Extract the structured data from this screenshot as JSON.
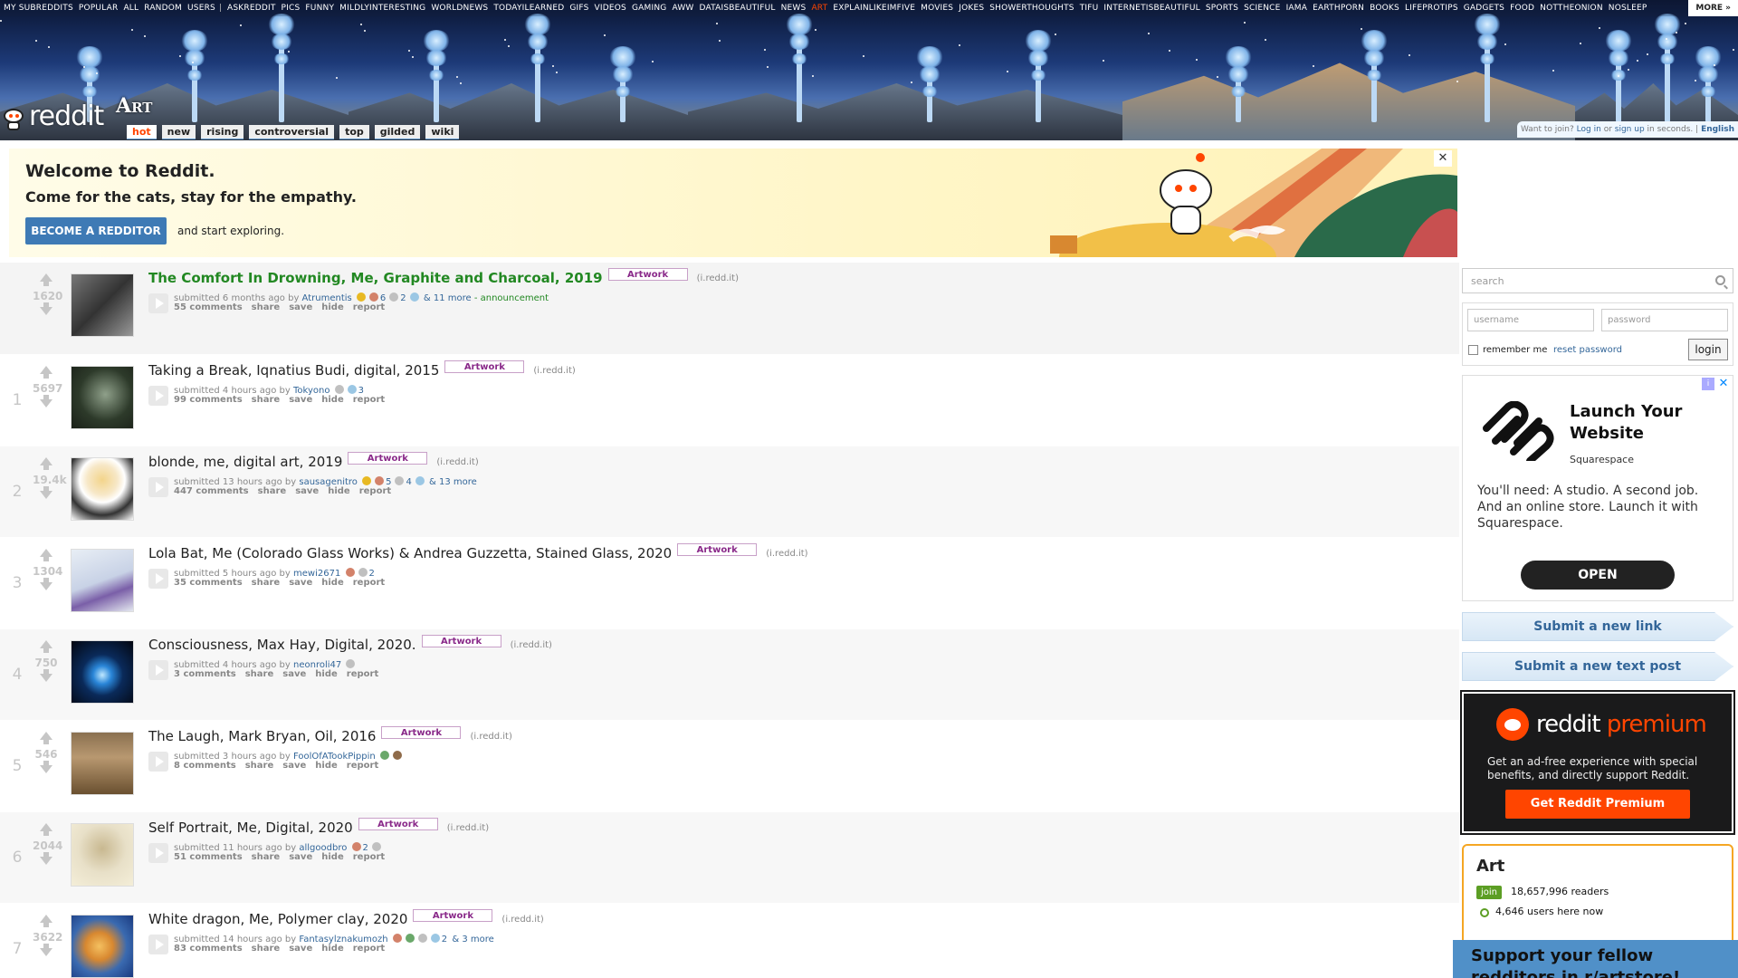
{
  "srbar": {
    "items": [
      "MY SUBREDDITS",
      "POPULAR",
      "ALL",
      "RANDOM",
      "USERS",
      "|",
      "ASKREDDIT",
      "PICS",
      "FUNNY",
      "MILDLYINTERESTING",
      "WORLDNEWS",
      "TODAYILEARNED",
      "GIFS",
      "VIDEOS",
      "GAMING",
      "AWW",
      "DATAISBEAUTIFUL",
      "NEWS",
      "ART",
      "EXPLAINLIKEIMFIVE",
      "MOVIES",
      "JOKES",
      "SHOWERTHOUGHTS",
      "TIFU",
      "INTERNETISBEAUTIFUL",
      "SPORTS",
      "SCIENCE",
      "IAMA",
      "EARTHPORN",
      "BOOKS",
      "LIFEPROTIPS",
      "GADGETS",
      "FOOD",
      "NOTTHEONION",
      "NOSLEEP"
    ],
    "selected": "ART",
    "more_label": "MORE »"
  },
  "header": {
    "logo_text": "reddit",
    "subreddit_name": "Art",
    "tabs": [
      "hot",
      "new",
      "rising",
      "controversial",
      "top",
      "gilded",
      "wiki"
    ],
    "selected_tab": "hot",
    "userbox": {
      "prefix": "Want to join?",
      "login": "Log in",
      "or": "or",
      "signup": "sign up",
      "suffix": "in seconds.",
      "sep": "|",
      "language": "English"
    }
  },
  "welcome": {
    "title": "Welcome to Reddit.",
    "subtitle": "Come for the cats, stay for the empathy.",
    "button": "BECOME A REDDITOR",
    "explore": "and start exploring.",
    "close": "✕"
  },
  "posts": [
    {
      "rank": "",
      "score": "1620",
      "title": "The Comfort In Drowning, Me, Graphite and Charcoal, 2019",
      "stickied": true,
      "flair": "Artwork",
      "domain": "(i.redd.it)",
      "submitted": "submitted 6 months ago by",
      "author": "Atrumentis",
      "awards": [
        {
          "t": "gold",
          "c": ""
        },
        {
          "t": "misc1",
          "c": "6"
        },
        {
          "t": "silver",
          "c": "2"
        },
        {
          "t": "plat",
          "c": ""
        }
      ],
      "more": "& 11 more",
      "extra": "- announcement",
      "comments": "55 comments",
      "thumb": "linear-gradient(135deg,#777,#333 50%,#999)"
    },
    {
      "rank": "1",
      "score": "5697",
      "title": "Taking a Break, Iqnatius Budi, digital, 2015",
      "flair": "Artwork",
      "domain": "(i.redd.it)",
      "submitted": "submitted 4 hours ago by",
      "author": "Tokyono",
      "awards": [
        {
          "t": "silver",
          "c": ""
        },
        {
          "t": "plat",
          "c": "3"
        }
      ],
      "more": "",
      "extra": "",
      "comments": "99 comments",
      "thumb": "radial-gradient(circle at 55% 45%,#8fa08a,#2d3a2a 55%,#1a2018)"
    },
    {
      "rank": "2",
      "score": "19.4k",
      "title": "blonde, me, digital art, 2019",
      "flair": "Artwork",
      "domain": "(i.redd.it)",
      "submitted": "submitted 13 hours ago by",
      "author": "sausagenitro",
      "awards": [
        {
          "t": "gold",
          "c": ""
        },
        {
          "t": "misc1",
          "c": "5"
        },
        {
          "t": "silver",
          "c": "4"
        },
        {
          "t": "plat",
          "c": ""
        }
      ],
      "more": "& 13 more",
      "extra": "",
      "comments": "447 comments",
      "thumb": "radial-gradient(circle at 50% 35%,#f3d48a,#f7e8c8 30%,#fff 45%,#333 70%,#fff)"
    },
    {
      "rank": "3",
      "score": "1304",
      "title": "Lola Bat, Me (Colorado Glass Works) & Andrea Guzzetta, Stained Glass, 2020",
      "flair": "Artwork",
      "domain": "(i.redd.it)",
      "submitted": "submitted 5 hours ago by",
      "author": "mewi2671",
      "awards": [
        {
          "t": "misc1",
          "c": ""
        },
        {
          "t": "silver",
          "c": "2"
        }
      ],
      "more": "",
      "extra": "",
      "comments": "35 comments",
      "thumb": "linear-gradient(160deg,#e8eef5,#c8d2e6 50%,#7a5fa8 70%,#e4e8f0)"
    },
    {
      "rank": "4",
      "score": "750",
      "title": "Consciousness, Max Hay, Digital, 2020.",
      "flair": "Artwork",
      "domain": "(i.redd.it)",
      "submitted": "submitted 4 hours ago by",
      "author": "neonroli47",
      "awards": [
        {
          "t": "silver",
          "c": ""
        }
      ],
      "more": "",
      "extra": "",
      "comments": "3 comments",
      "thumb": "radial-gradient(circle at 50% 55%,#bfe8ff,#2a86d8 20%,#0a2a5a 45%,#03060f)"
    },
    {
      "rank": "5",
      "score": "546",
      "title": "The Laugh, Mark Bryan, Oil, 2016",
      "flair": "Artwork",
      "domain": "(i.redd.it)",
      "submitted": "submitted 3 hours ago by",
      "author": "FoolOfATookPippin",
      "awards": [
        {
          "t": "misc2",
          "c": ""
        },
        {
          "t": "misc3",
          "c": ""
        }
      ],
      "more": "",
      "extra": "",
      "comments": "8 comments",
      "thumb": "linear-gradient(180deg,#8a7050,#b89870 40%,#6a5030)"
    },
    {
      "rank": "6",
      "score": "2044",
      "title": "Self Portrait, Me, Digital, 2020",
      "flair": "Artwork",
      "domain": "(i.redd.it)",
      "submitted": "submitted 11 hours ago by",
      "author": "allgoodbro",
      "awards": [
        {
          "t": "misc1",
          "c": "2"
        },
        {
          "t": "silver",
          "c": ""
        }
      ],
      "more": "",
      "extra": "",
      "comments": "51 comments",
      "thumb": "radial-gradient(circle at 50% 40%,#c8b890,#e8e0c8 50%,#f4eed8)"
    },
    {
      "rank": "7",
      "score": "3622",
      "title": "White dragon, Me, Polymer clay, 2020",
      "flair": "Artwork",
      "domain": "(i.redd.it)",
      "submitted": "submitted 14 hours ago by",
      "author": "Fantasylznakumozh",
      "awards": [
        {
          "t": "misc1",
          "c": ""
        },
        {
          "t": "misc2",
          "c": ""
        },
        {
          "t": "silver",
          "c": ""
        },
        {
          "t": "plat",
          "c": "2"
        }
      ],
      "more": "& 3 more",
      "extra": "",
      "comments": "83 comments",
      "thumb": "radial-gradient(circle at 45% 50%,#f4c060,#d88830 30%,#3a6ab0 60%,#1a3a80)"
    }
  ],
  "post_buttons": [
    "share",
    "save",
    "hide",
    "report"
  ],
  "sidebar": {
    "search_placeholder": "search",
    "username_placeholder": "username",
    "password_placeholder": "password",
    "remember_me": "remember me",
    "reset_password": "reset password",
    "login": "login",
    "ad": {
      "info": "i",
      "close": "✕",
      "title": "Launch Your Website",
      "brand": "Squarespace",
      "body": "You'll need: A studio. A second job. And an online store. Launch it with Squarespace.",
      "cta": "OPEN"
    },
    "submit_link": "Submit a new link",
    "submit_text": "Submit a new text post",
    "premium": {
      "word1": "reddit",
      "word2": "premium",
      "text": "Get an ad-free experience with special benefits, and directly support Reddit.",
      "button": "Get Reddit Premium"
    },
    "subinfo": {
      "name": "Art",
      "join": "join",
      "readers": "18,657,996 readers",
      "online": "4,646 users here now"
    },
    "support": "Support your fellow redditors in r/artstore!"
  }
}
